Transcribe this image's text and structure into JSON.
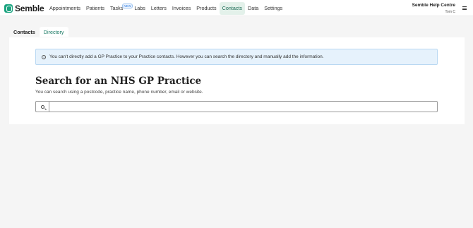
{
  "app": {
    "name": "Semble"
  },
  "nav": {
    "items": [
      {
        "label": "Appointments"
      },
      {
        "label": "Patients"
      },
      {
        "label": "Tasks",
        "badge": "NEW"
      },
      {
        "label": "Labs"
      },
      {
        "label": "Letters"
      },
      {
        "label": "Invoices"
      },
      {
        "label": "Products"
      },
      {
        "label": "Contacts",
        "active": true
      },
      {
        "label": "Data"
      },
      {
        "label": "Settings"
      }
    ]
  },
  "help": {
    "title": "Semble Help Centre",
    "user": "Tom C"
  },
  "tabs": [
    {
      "label": "Contacts"
    },
    {
      "label": "Directory",
      "active": true
    }
  ],
  "main": {
    "info": "You can't directly add a GP Practice to your Practice contacts. However you can search the directory and manually add the information.",
    "heading": "Search for an NHS GP Practice",
    "subtext": "You can search using a postcode, practice name, phone number, email or website.",
    "search": {
      "value": "",
      "placeholder": ""
    }
  },
  "colors": {
    "accent": "#1aa37f",
    "info_bg": "#e6f2fc",
    "info_border": "#b9d8f2"
  }
}
